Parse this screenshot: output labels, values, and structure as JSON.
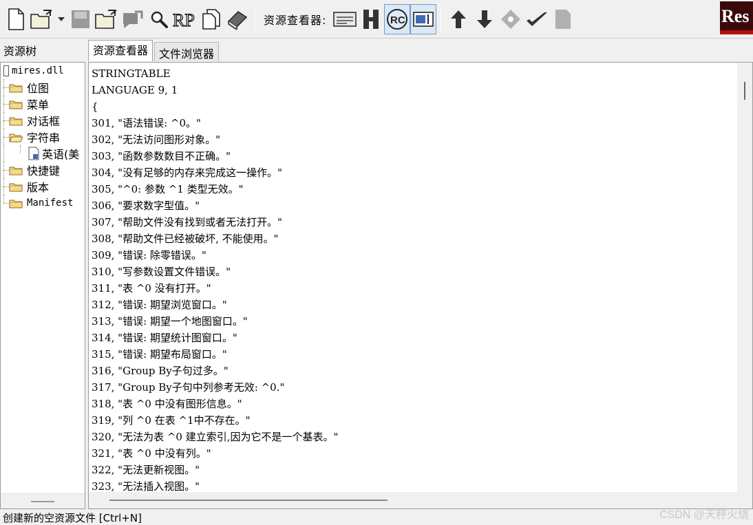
{
  "toolbar": {
    "viewer_label": "资源查看器:",
    "logo_text": "Res"
  },
  "left_panel": {
    "title": "资源树"
  },
  "tabs": [
    {
      "label": "资源查看器"
    },
    {
      "label": "文件浏览器"
    }
  ],
  "tree": {
    "root": "mires.dll",
    "items": [
      {
        "label": "位图"
      },
      {
        "label": "菜单"
      },
      {
        "label": "对话框"
      },
      {
        "label": "字符串"
      },
      {
        "label": "快捷键"
      },
      {
        "label": "版本"
      },
      {
        "label": "Manifest"
      }
    ],
    "child_label": "英语(美"
  },
  "editor": {
    "lines": [
      "STRINGTABLE",
      "LANGUAGE 9, 1",
      "{",
      "301, \"语法错误: ^0。\"",
      "302, \"无法访问图形对象。\"",
      "303, \"函数参数数目不正确。\"",
      "304, \"没有足够的内存来完成这一操作。\"",
      "305, \"^0: 参数 ^1 类型无效。\"",
      "306, \"要求数字型值。\"",
      "307, \"帮助文件没有找到或者无法打开。\"",
      "308, \"帮助文件已经被破坏, 不能使用。\"",
      "309, \"错误: 除零错误。\"",
      "310, \"写参数设置文件错误。\"",
      "311, \"表 ^0 没有打开。\"",
      "312, \"错误: 期望浏览窗口。\"",
      "313, \"错误: 期望一个地图窗口。\"",
      "314, \"错误: 期望统计图窗口。\"",
      "315, \"错误: 期望布局窗口。\"",
      "316, \"Group By子句过多。\"",
      "317, \"Group By子句中列参考无效: ^0.\"",
      "318, \"表 ^0 中没有图形信息。\"",
      "319, \"列 ^0 在表 ^1中不存在。\"",
      "320, \"无法为表 ^0 建立索引,因为它不是一个基表。\"",
      "321, \"表 ^0 中没有列。\"",
      "322, \"无法更新视图。\"",
      "323, \"无法插入视图。\""
    ]
  },
  "status": {
    "text": "创建新的空资源文件 [Ctrl+N]"
  },
  "watermark": "CSDN @天秤火烧"
}
